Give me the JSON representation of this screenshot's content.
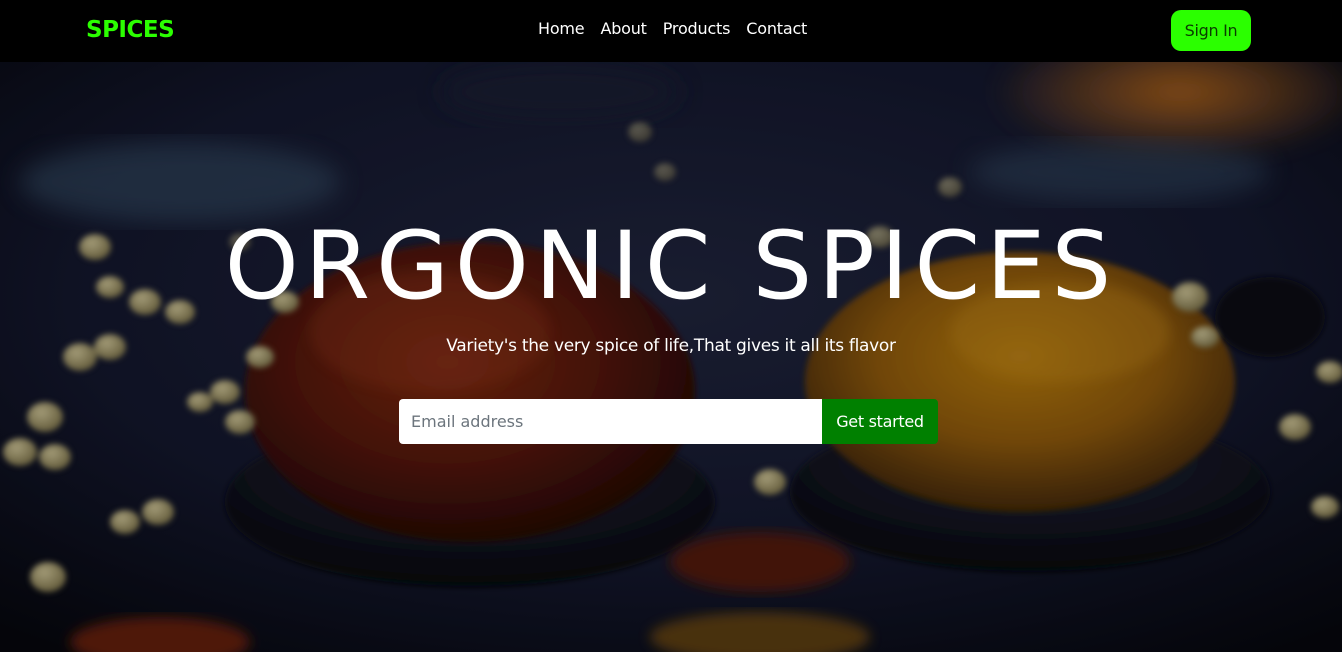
{
  "navbar": {
    "brand": "SPICES",
    "links": [
      "Home",
      "About",
      "Products",
      "Contact"
    ],
    "signin_label": "Sign In"
  },
  "hero": {
    "title": "ORGONIC SPICES",
    "subtitle": "Variety's the very spice of life,That gives it all its flavor",
    "email_placeholder": "Email address",
    "email_value": "",
    "cta_label": "Get started"
  },
  "colors": {
    "brand_green": "#2bff00",
    "cta_green": "#008000",
    "navbar_bg": "#000000"
  }
}
